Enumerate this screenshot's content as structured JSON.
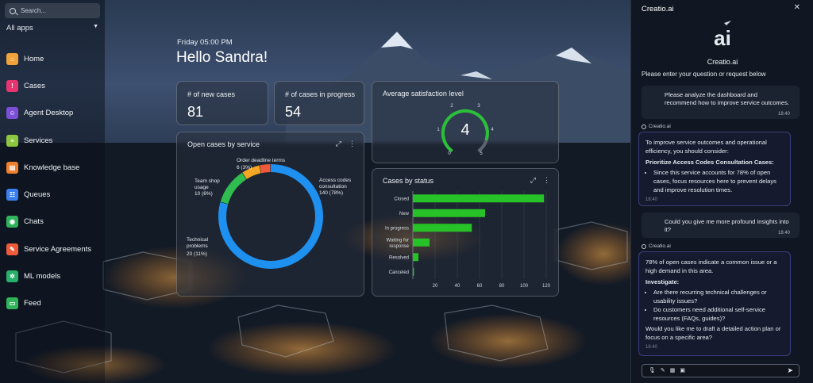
{
  "sidebar": {
    "search_placeholder": "Search...",
    "all_apps": "All apps",
    "items": [
      {
        "label": "Home",
        "icon": "home-icon",
        "color": "#f2a23a",
        "glyph": "⌂"
      },
      {
        "label": "Cases",
        "icon": "cases-icon",
        "color": "#e8356f",
        "glyph": "!"
      },
      {
        "label": "Agent Desktop",
        "icon": "agent-desktop-icon",
        "color": "#7b4fd8",
        "glyph": "☺"
      },
      {
        "label": "Services",
        "icon": "services-icon",
        "color": "#8dc63f",
        "glyph": "≡"
      },
      {
        "label": "Knowledge base",
        "icon": "knowledge-base-icon",
        "color": "#f07f2c",
        "glyph": "▤"
      },
      {
        "label": "Queues",
        "icon": "queues-icon",
        "color": "#3a7ff0",
        "glyph": "☷"
      },
      {
        "label": "Chats",
        "icon": "chats-icon",
        "color": "#2fb45a",
        "glyph": "◉"
      },
      {
        "label": "Service Agreements",
        "icon": "service-agreements-icon",
        "color": "#ee5a3a",
        "glyph": "✎"
      },
      {
        "label": "ML models",
        "icon": "ml-models-icon",
        "color": "#27b06a",
        "glyph": "✲"
      },
      {
        "label": "Feed",
        "icon": "feed-icon",
        "color": "#2fb45a",
        "glyph": "▭"
      }
    ]
  },
  "header": {
    "datetime": "Friday 05:00 PM",
    "greeting": "Hello Sandra!"
  },
  "kpis": {
    "new_cases": {
      "label": "# of new cases",
      "value": "81"
    },
    "in_progress": {
      "label": "# of cases in progress",
      "value": "54"
    }
  },
  "satisfaction": {
    "title": "Average satisfaction level",
    "value": "4",
    "ticks": [
      "0",
      "1",
      "2",
      "3",
      "4",
      "5"
    ]
  },
  "open_cases": {
    "title": "Open cases by service",
    "labels": {
      "order": {
        "name": "Order deadline terms",
        "value": "6 (3%)"
      },
      "team": {
        "name1": "Team shop",
        "name2": "usage",
        "value": "10 (6%)"
      },
      "access": {
        "name1": "Access codes",
        "name2": "consultation",
        "value": "140 (78%)"
      },
      "tech": {
        "name1": "Technical",
        "name2": "problems",
        "value": "20 (11%)"
      }
    }
  },
  "status_chart": {
    "title": "Cases by status"
  },
  "chart_data": [
    {
      "type": "pie",
      "title": "Open cases by service",
      "categories": [
        "Access codes consultation",
        "Technical problems",
        "Team shop usage",
        "Order deadline terms"
      ],
      "values": [
        140,
        20,
        10,
        6
      ],
      "colors": [
        "#1e90f0",
        "#2ebd4e",
        "#f5a623",
        "#f05a3c"
      ],
      "donut": true
    },
    {
      "type": "bar",
      "orientation": "horizontal",
      "title": "Cases by status",
      "categories": [
        "Closed",
        "New",
        "In progress",
        "Waiting for response",
        "Resolved",
        "Canceled"
      ],
      "values": [
        118,
        65,
        53,
        15,
        5,
        1
      ],
      "xlim": [
        0,
        125
      ],
      "xticks": [
        20,
        40,
        60,
        80,
        100,
        120
      ],
      "color": "#27c227"
    }
  ],
  "ai_panel": {
    "header": "Creatio.ai",
    "name": "Creatio.ai",
    "subtitle": "Please enter your question or request below",
    "msg1": {
      "text": "Please analyze the dashboard and recommend how to improve service outcomes.",
      "time": "18:40"
    },
    "tag": "Creatio.ai",
    "reply1": {
      "intro": "To improve service outcomes and operational efficiency, you should consider:",
      "heading": "Prioritize Access Codes Consultation Cases:",
      "bullet": "Since this service accounts for 78% of open cases, focus resources here to prevent delays and improve resolution times.",
      "time": "18:40"
    },
    "msg2": {
      "text": "Could you give me more profound insights into it?",
      "time": "18:40"
    },
    "reply2": {
      "intro": "78% of open cases indicate a common issue or a high demand in this area.",
      "heading": "Investigate:",
      "bullet1": "Are there recurring technical challenges or usability issues?",
      "bullet2": "Do customers need additional self-service resources (FAQs, guides)?",
      "outro": "Would you like me to draft a detailed action plan or focus on a specific area?",
      "time": "18:40"
    }
  }
}
